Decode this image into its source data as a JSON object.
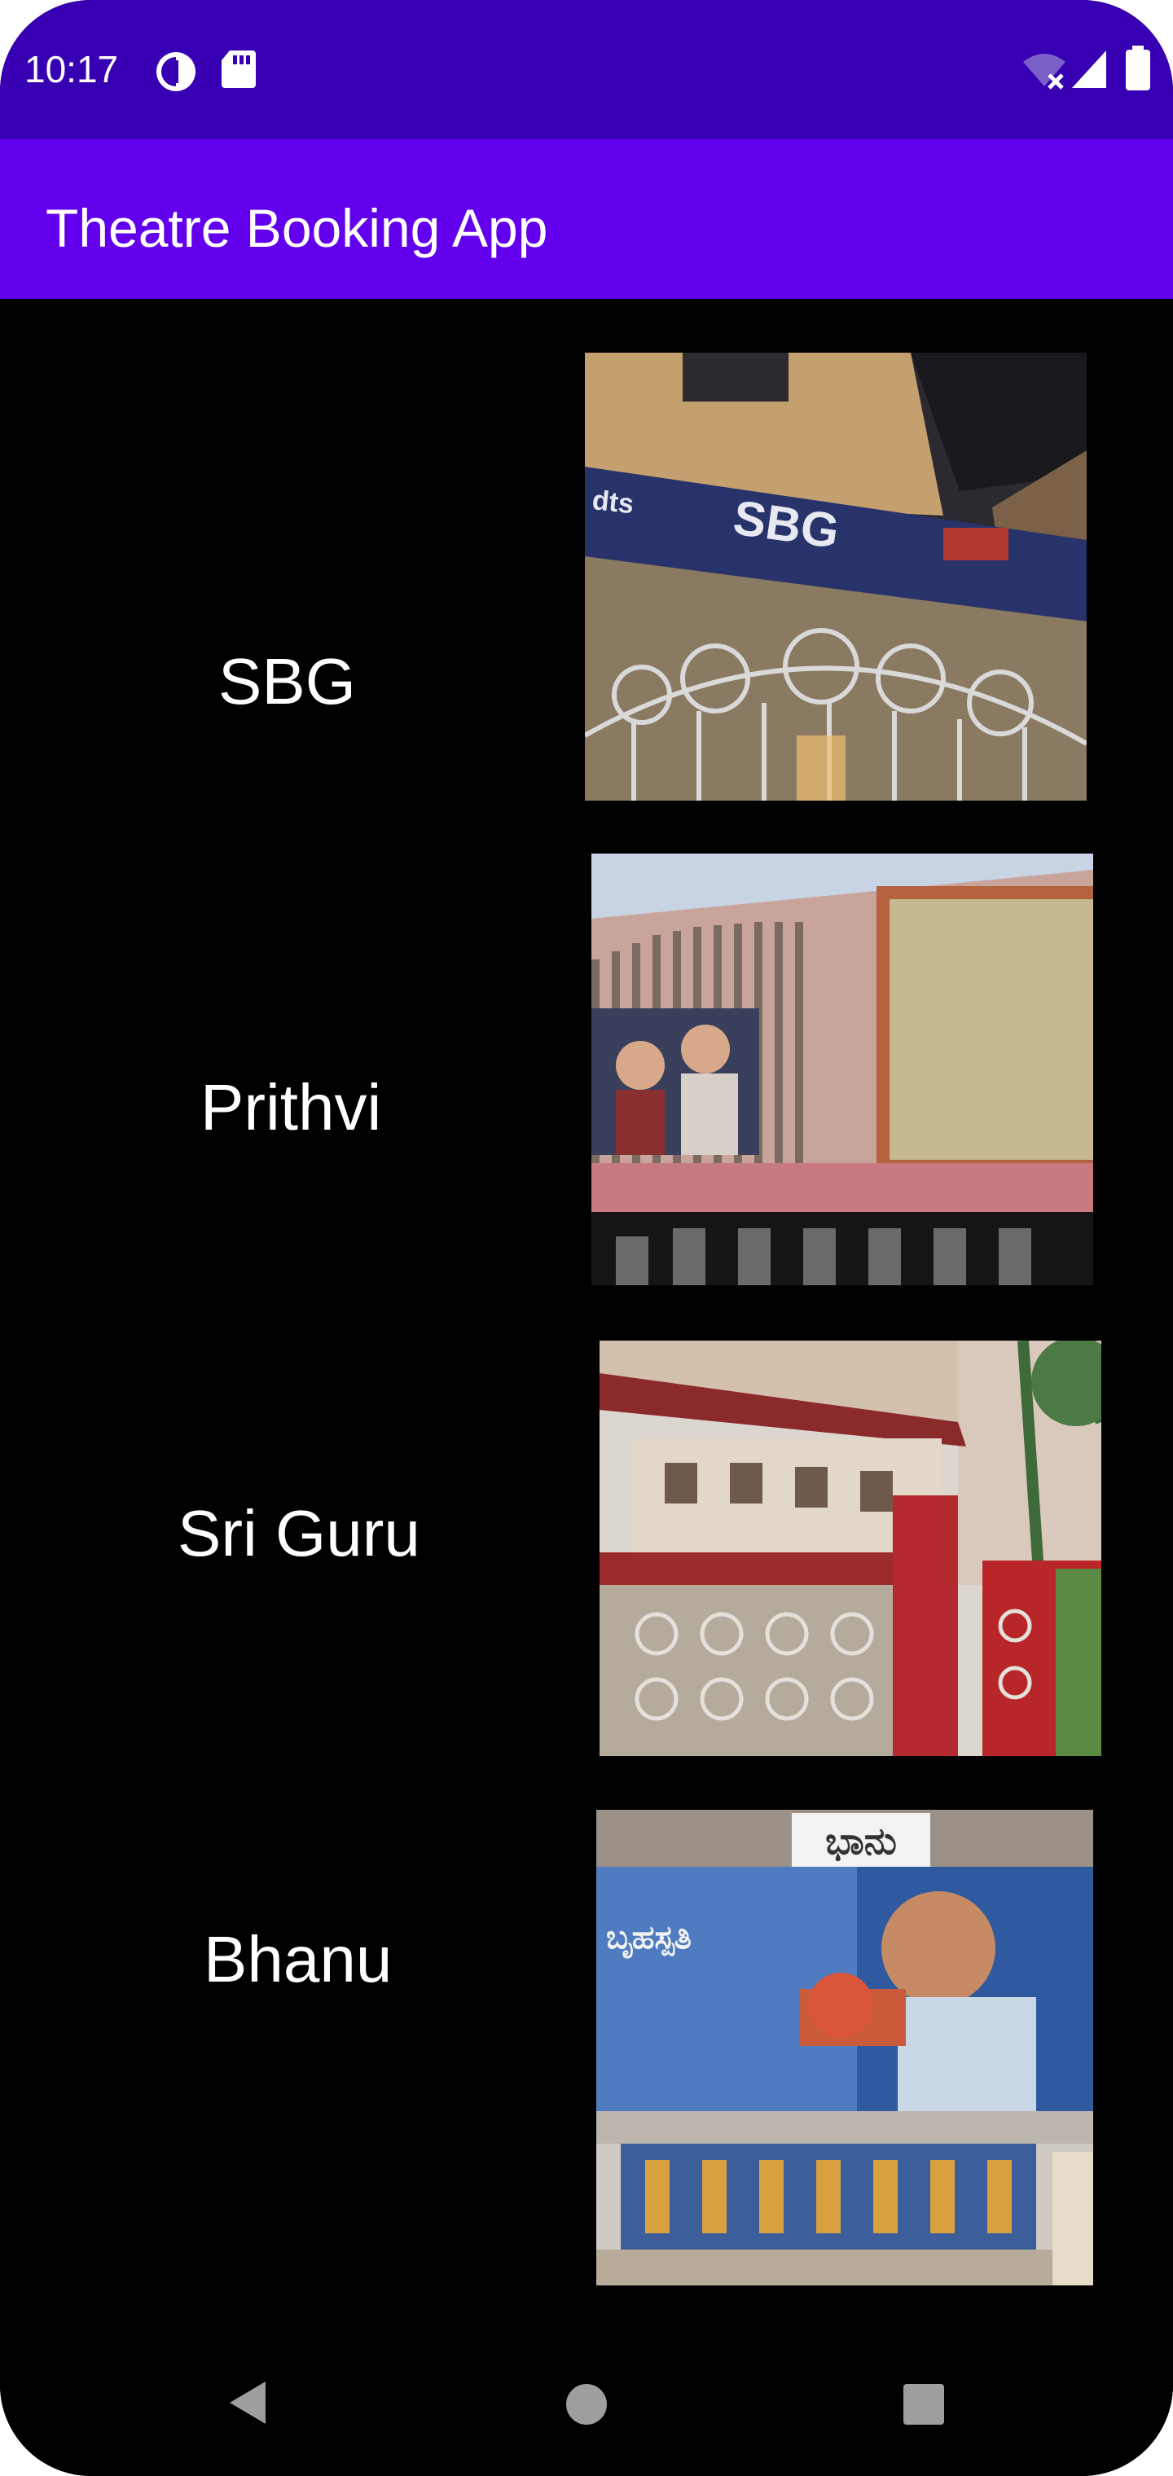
{
  "status_bar": {
    "time": "10:17",
    "icons": [
      "data-saver-icon",
      "sd-card-icon",
      "wifi-off-icon",
      "cell-signal-icon",
      "battery-icon"
    ],
    "background": "#3700B3"
  },
  "app_bar": {
    "title": "Theatre Booking App",
    "background": "#6200EE"
  },
  "theatres": [
    {
      "name": "SBG",
      "image_icon": "sbg-theatre-photo"
    },
    {
      "name": "Prithvi",
      "image_icon": "prithvi-theatre-photo"
    },
    {
      "name": "Sri Guru",
      "image_icon": "sri-guru-theatre-photo"
    },
    {
      "name": "Bhanu",
      "image_icon": "bhanu-theatre-photo"
    }
  ],
  "photo_text": {
    "sbg_sign": "SBG",
    "sbg_side": "dts",
    "bhanu_sign": "ಭಾನು",
    "bhanu_poster": "ಬೃಹಸ್ಪತಿ"
  },
  "nav_bar": {
    "buttons": [
      "back-button",
      "home-button",
      "recents-button"
    ]
  }
}
